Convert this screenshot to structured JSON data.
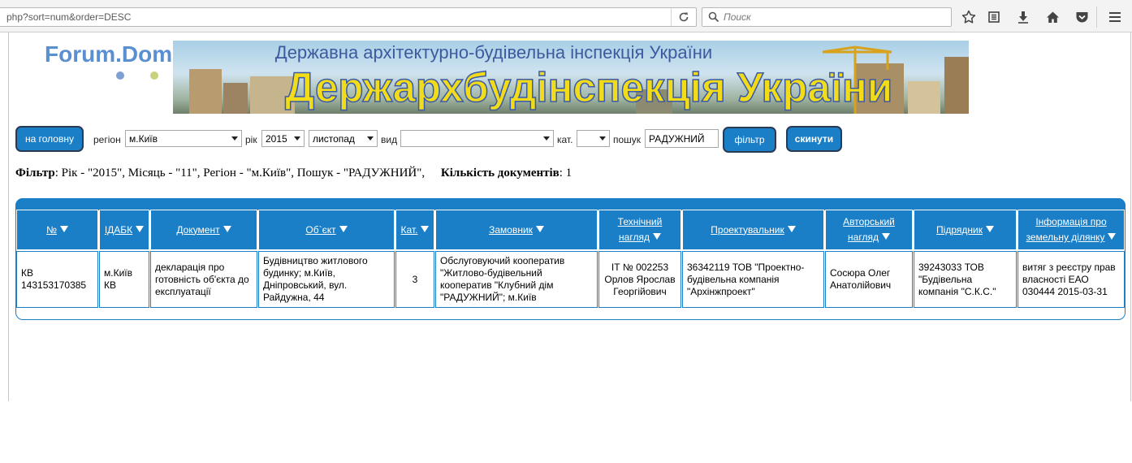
{
  "browser": {
    "url": "php?sort=num&order=DESC",
    "search_placeholder": "Поиск"
  },
  "header": {
    "logo_text": "Forum.Domik.ua",
    "banner_subtitle": "Державна архітектурно-будівельна інспекція України",
    "banner_title": "Держархбудінспекція України"
  },
  "filters": {
    "home_button": "на головну",
    "region_label": "регіон",
    "region_value": "м.Київ",
    "year_label": "рік",
    "year_value": "2015",
    "month_value": "листопад",
    "type_label": "вид",
    "type_value": "",
    "cat_label": "кат.",
    "cat_value": "",
    "search_label": "пошук",
    "search_value": "РАДУЖНИЙ",
    "filter_button": "фільтр",
    "reset_button": "скинути"
  },
  "summary": {
    "filter_label": "Фільтр",
    "filter_text": ": Рік - \"2015\", Місяць - \"11\", Регіон - \"м.Київ\", Пошук - \"РАДУЖНИЙ\",",
    "count_label": "Кількість документів",
    "count_value": ": 1"
  },
  "table": {
    "headers": [
      {
        "line1": "№",
        "line2": ""
      },
      {
        "line1": "ІДАБК",
        "line2": ""
      },
      {
        "line1": "Документ",
        "line2": ""
      },
      {
        "line1": "Об`єкт",
        "line2": ""
      },
      {
        "line1": "Кат.",
        "line2": ""
      },
      {
        "line1": "Замовник",
        "line2": ""
      },
      {
        "line1": "Технічний",
        "line2": "нагляд"
      },
      {
        "line1": "Проектувальник",
        "line2": ""
      },
      {
        "line1": "Авторський",
        "line2": "нагляд"
      },
      {
        "line1": "Підрядник",
        "line2": ""
      },
      {
        "line1": "Інформація про",
        "line2": "земельну ділянку"
      }
    ],
    "rows": [
      {
        "num": "КВ 143153170385",
        "idabk": "м.Київ КВ",
        "document": "декларація про готовність об'єкта до експлуатації",
        "object": "Будівництво житлового будинку; м.Київ, Дніпровський, вул. Райдужна, 44",
        "cat": "3",
        "customer": "Обслуговуючий кооператив \"Житлово-будівельний кооператив \"Клубний дім \"РАДУЖНИЙ\"; м.Київ",
        "tech_supervision": "ІТ № 002253 Орлов Ярослав Георгійович",
        "designer": "36342119 ТОВ \"Проектно-будівельна компанія \"Архінжпроект\"",
        "author_supervision": "Сосюра Олег Анатолійович",
        "contractor": "39243033 ТОВ \"Будівельна компанія \"С.К.С.\"",
        "land_info": "витяг з реєстру прав власності ЕАО 030444 2015-03-31"
      }
    ]
  },
  "colors": {
    "accent": "#1a7fc7",
    "button_border": "#2a3a52",
    "banner_yellow": "#f2dc1a",
    "logo_blue": "#5a8fd0"
  },
  "icons": [
    "reload-icon",
    "search-icon",
    "bookmark-star-icon",
    "reading-list-icon",
    "download-icon",
    "home-icon",
    "pocket-icon",
    "menu-icon"
  ]
}
